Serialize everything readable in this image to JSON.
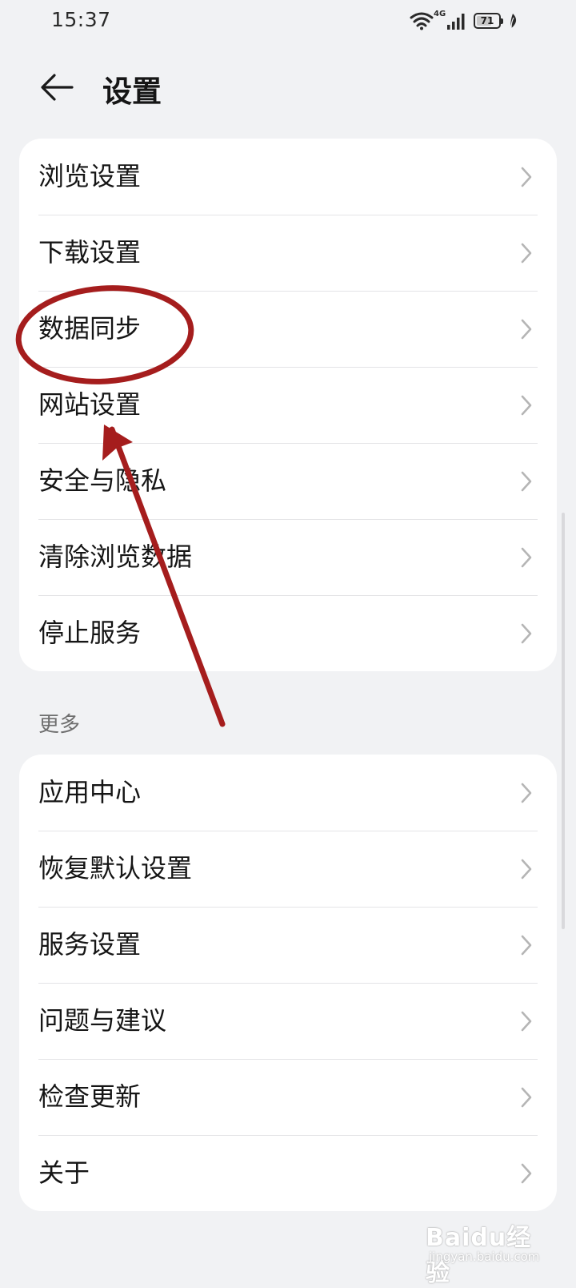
{
  "status_bar": {
    "time": "15:37",
    "network": "4G",
    "battery": "71",
    "battery_level": 0.71
  },
  "header": {
    "title": "设置",
    "back_icon": "arrow-left-icon"
  },
  "main_card": {
    "items": [
      {
        "label": "浏览设置"
      },
      {
        "label": "下载设置"
      },
      {
        "label": "数据同步"
      },
      {
        "label": "网站设置"
      },
      {
        "label": "安全与隐私"
      },
      {
        "label": "清除浏览数据"
      },
      {
        "label": "停止服务"
      }
    ]
  },
  "more_section": {
    "title": "更多",
    "items": [
      {
        "label": "应用中心"
      },
      {
        "label": "恢复默认设置"
      },
      {
        "label": "服务设置"
      },
      {
        "label": "问题与建议"
      },
      {
        "label": "检查更新"
      },
      {
        "label": "关于"
      }
    ]
  },
  "annotation": {
    "color": "#a51d1d",
    "highlighted_item": "数据同步"
  },
  "watermark": {
    "brand": "Baidu经验",
    "domain": "jingyan.baidu.com"
  },
  "colors": {
    "background": "#f1f2f4",
    "card": "#ffffff",
    "divider": "#e4e4e6",
    "chevron": "#b5b5b5"
  }
}
